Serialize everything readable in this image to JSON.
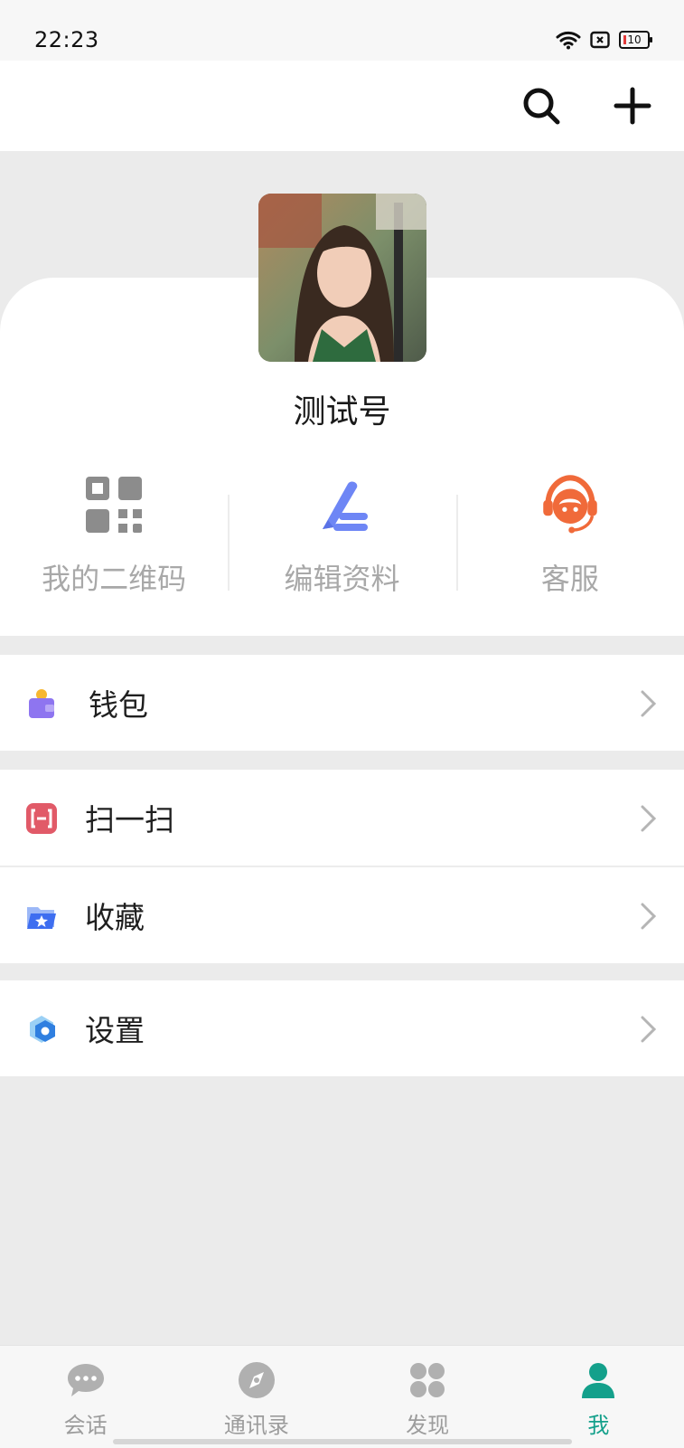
{
  "status_bar": {
    "time": "22:23",
    "battery_level": "10"
  },
  "top_bar": {
    "search_icon": "search-icon",
    "add_icon": "plus-icon"
  },
  "profile": {
    "name": "测试号",
    "avatar": "user-photo-avatar"
  },
  "actions": [
    {
      "label": "我的二维码",
      "icon": "qr-code-icon",
      "color": "#8c8c8c"
    },
    {
      "label": "编辑资料",
      "icon": "edit-pen-icon",
      "color": "#6e86f5"
    },
    {
      "label": "客服",
      "icon": "headset-support-icon",
      "color": "#f06a3a"
    }
  ],
  "menu": {
    "wallet": {
      "label": "钱包",
      "icon": "wallet-icon"
    },
    "scan": {
      "label": "扫一扫",
      "icon": "scan-icon"
    },
    "favorites": {
      "label": "收藏",
      "icon": "favorites-folder-icon"
    },
    "settings": {
      "label": "设置",
      "icon": "settings-hexagon-icon"
    }
  },
  "bottom_nav": [
    {
      "label": "会话",
      "icon": "chat-bubble-icon",
      "active": false
    },
    {
      "label": "通讯录",
      "icon": "compass-icon",
      "active": false
    },
    {
      "label": "发现",
      "icon": "discover-grid-icon",
      "active": false
    },
    {
      "label": "我",
      "icon": "person-icon",
      "active": true
    }
  ],
  "colors": {
    "accent": "#14a08b",
    "background": "#ebebeb"
  }
}
